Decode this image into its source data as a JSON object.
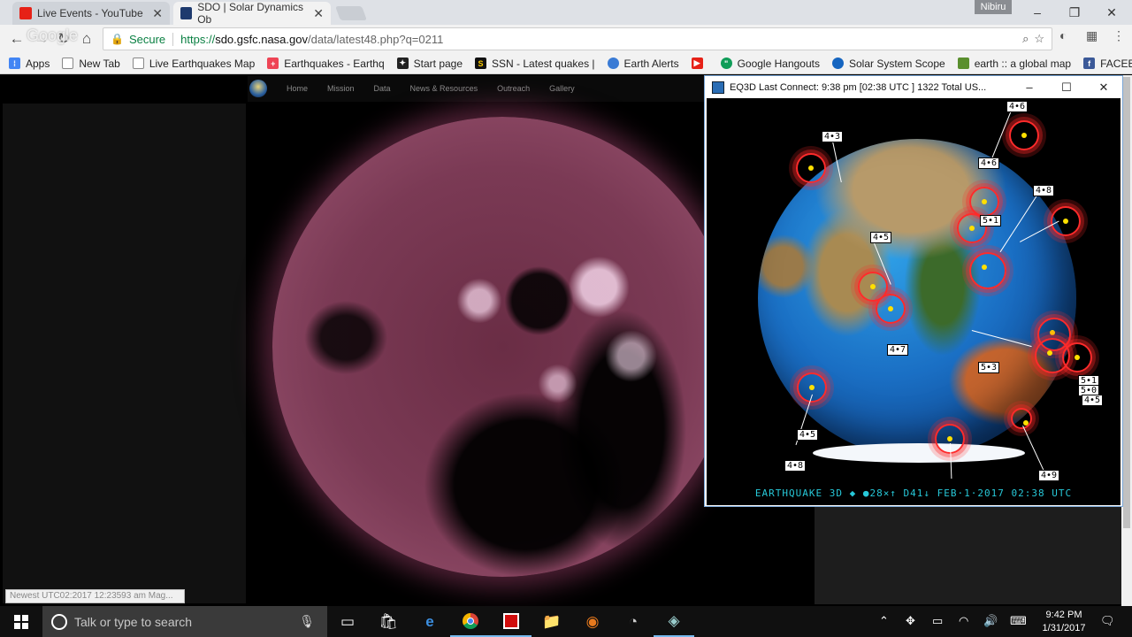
{
  "browser": {
    "tabs": [
      {
        "title": "Live Events - YouTube",
        "active": false
      },
      {
        "title": "SDO | Solar Dynamics Ob",
        "active": true
      }
    ],
    "profile_name": "Nibiru",
    "omnibox": {
      "secure_label": "Secure",
      "url_proto": "https://",
      "url_host": "sdo.gsfc.nasa.gov",
      "url_path": "/data/latest48.php?q=0211"
    },
    "bookmarks": [
      "Apps",
      "New Tab",
      "Live Earthquakes Map",
      "Earthquakes - Earthq",
      "Start page",
      "SSN - Latest quakes |",
      "Earth Alerts",
      "",
      "Google Hangouts",
      "Solar System Scope",
      "earth :: a global map",
      "FACEBOOK"
    ],
    "overflow": "»",
    "google_overlay": "Google"
  },
  "site": {
    "nav": [
      "Home",
      "Mission",
      "Data",
      "News & Resources",
      "Outreach",
      "Gallery"
    ],
    "status_text": "Newest UTC02:2017  12:23593 am  Mag..."
  },
  "eq3d": {
    "title": "EQ3D  Last Connect: 9:38 pm  [02:38 UTC ]     1322  Total    US...",
    "footer": "EARTHQUAKE 3D  ◆   ●28×↑ D41↓ FEB·1·2017 02:38 UTC",
    "mag_labels": [
      "4•3",
      "4•6",
      "4•6",
      "4•8",
      "5•1",
      "4•5",
      "4•7",
      "5•3",
      "5•1",
      "5•0",
      "4•5",
      "4•5",
      "4•8",
      "4•9",
      "4•8"
    ]
  },
  "taskbar": {
    "search_placeholder": "Talk or type to search",
    "time": "9:42 PM",
    "date": "1/31/2017"
  },
  "colors": {
    "eq_ring": "#ff2b2b",
    "eq_footer": "#27c8d8",
    "secure_green": "#0b8043",
    "tab_bar": "#dee1e6"
  }
}
